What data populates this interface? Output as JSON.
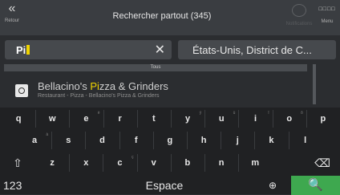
{
  "topbar": {
    "back_label": "Retour",
    "back_icon": "«",
    "title": "Rechercher partout (345)",
    "notifications_label": "Notifications",
    "menu_label": "Menu",
    "menu_icon": "□□□□"
  },
  "search": {
    "value": "Pi",
    "clear_icon": "✕",
    "country": "États-Unis, District de C..."
  },
  "filter": {
    "label": "Tous"
  },
  "results": [
    {
      "name_before": "Bellacino's ",
      "name_match": "Pi",
      "name_after": "zza & Grinders",
      "subtitle": "Restaurant - Pizza - Bellacino's Pizza & Grinders"
    }
  ],
  "keyboard": {
    "row1": [
      {
        "k": "q",
        "s": ""
      },
      {
        "k": "w",
        "s": ""
      },
      {
        "k": "e",
        "s": "è"
      },
      {
        "k": "r",
        "s": ""
      },
      {
        "k": "t",
        "s": ""
      },
      {
        "k": "y",
        "s": "ÿ"
      },
      {
        "k": "u",
        "s": "ü"
      },
      {
        "k": "i",
        "s": "î"
      },
      {
        "k": "o",
        "s": "ô"
      },
      {
        "k": "p",
        "s": ""
      }
    ],
    "row2": [
      {
        "k": "a",
        "s": "à"
      },
      {
        "k": "s",
        "s": ""
      },
      {
        "k": "d",
        "s": ""
      },
      {
        "k": "f",
        "s": ""
      },
      {
        "k": "g",
        "s": ""
      },
      {
        "k": "h",
        "s": ""
      },
      {
        "k": "j",
        "s": ""
      },
      {
        "k": "k",
        "s": ""
      },
      {
        "k": "l",
        "s": ""
      }
    ],
    "row3": [
      {
        "k": "z",
        "s": ""
      },
      {
        "k": "x",
        "s": ""
      },
      {
        "k": "c",
        "s": "ç"
      },
      {
        "k": "v",
        "s": ""
      },
      {
        "k": "b",
        "s": ""
      },
      {
        "k": "n",
        "s": ""
      },
      {
        "k": "m",
        "s": ""
      }
    ],
    "shift_icon": "⇧",
    "backspace_icon": "⌫",
    "numbers_label": "123",
    "space_label": "Espace",
    "globe_icon": "⊕",
    "search_icon": "🔍"
  }
}
